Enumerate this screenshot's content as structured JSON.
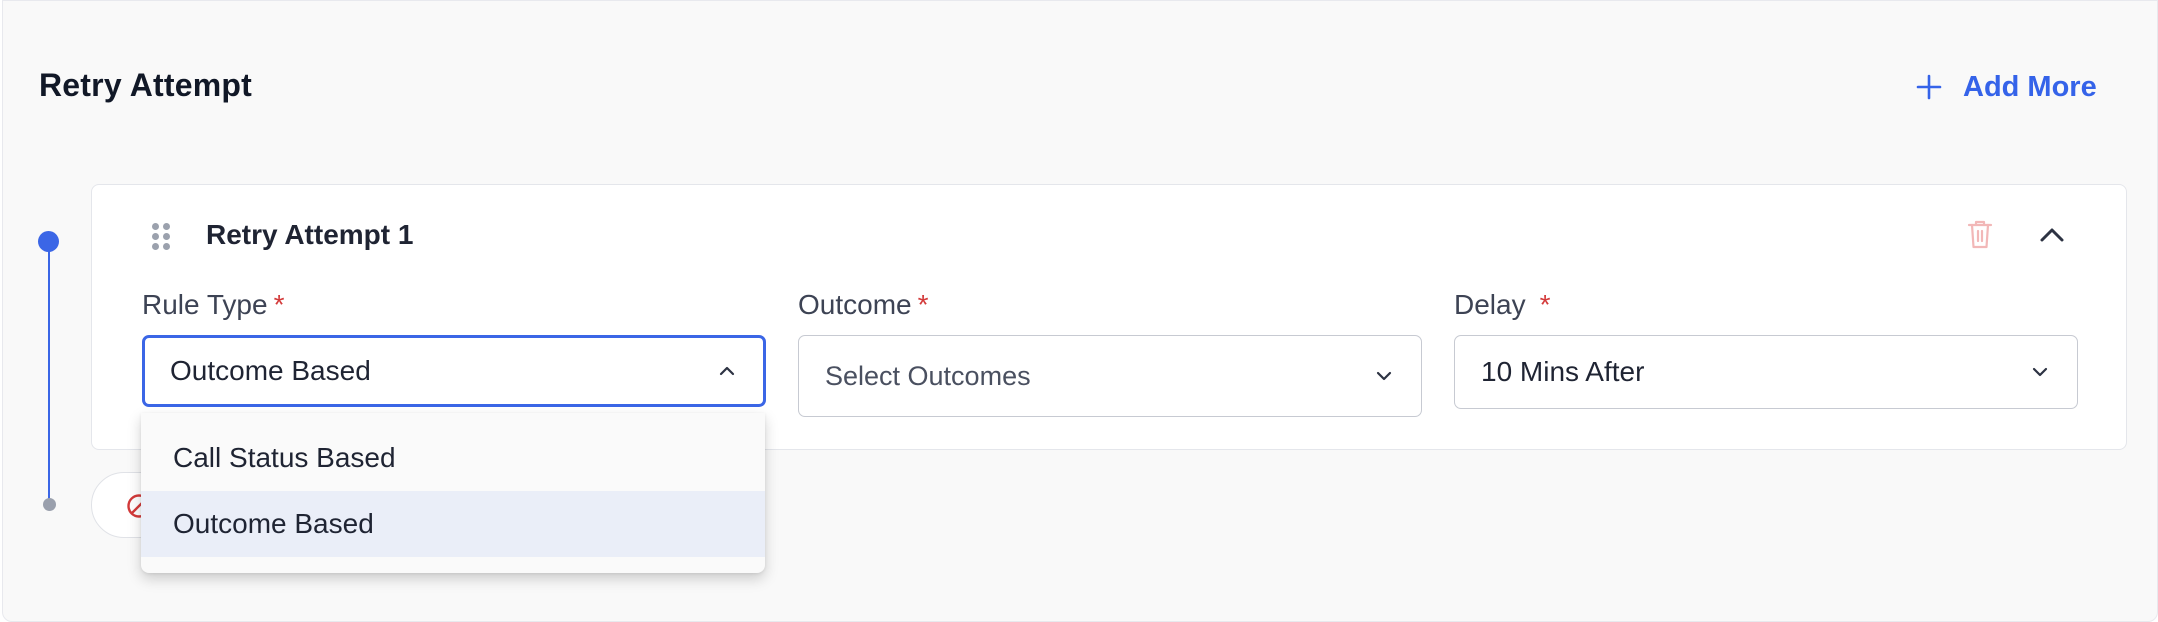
{
  "section": {
    "title": "Retry Attempt",
    "add_more_label": "Add More"
  },
  "attempt": {
    "title": "Retry Attempt 1",
    "fields": {
      "rule_type": {
        "label": "Rule Type",
        "required_mark": "*",
        "value": "Outcome Based"
      },
      "outcome": {
        "label": "Outcome",
        "required_mark": "*",
        "placeholder": "Select Outcomes"
      },
      "delay": {
        "label": "Delay",
        "required_mark": "*",
        "value": "10 Mins After"
      }
    }
  },
  "dropdown": {
    "options": [
      {
        "label": "Call Status Based",
        "selected": false
      },
      {
        "label": "Outcome Based",
        "selected": true
      }
    ]
  },
  "colors": {
    "accent": "#3b66e6",
    "required": "#d33a3a",
    "delete_icon": "#f2b8b8",
    "selected_option_bg": "#eaeef8"
  },
  "icons": [
    "plus-icon",
    "drag-handle-icon",
    "trash-icon",
    "chevron-up-icon",
    "chevron-down-icon",
    "block-icon"
  ]
}
